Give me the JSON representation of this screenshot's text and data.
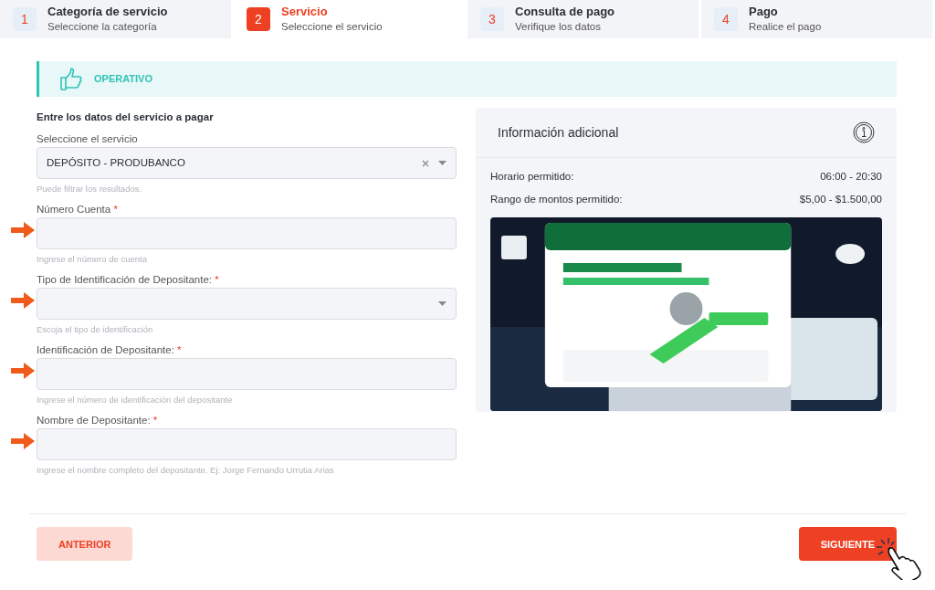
{
  "steps": [
    {
      "number": "1",
      "title": "Categoría de servicio",
      "subtitle": "Seleccione la categoría",
      "selected": false
    },
    {
      "number": "2",
      "title": "Servicio",
      "subtitle": "Seleccione el servicio",
      "selected": true
    },
    {
      "number": "3",
      "title": "Consulta de pago",
      "subtitle": "Verifique los datos",
      "selected": false
    },
    {
      "number": "4",
      "title": "Pago",
      "subtitle": "Realice el pago",
      "selected": false
    }
  ],
  "status_banner": {
    "label": "OPERATIVO"
  },
  "form": {
    "heading": "Entre los datos del servicio a pagar",
    "fields": [
      {
        "kind": "select",
        "label": "Seleccione el servicio",
        "value": "DEPÓSITO - PRODUBANCO",
        "clearable": true,
        "hint": "Puede filtrar los resultados.",
        "highlighted": false
      },
      {
        "kind": "text",
        "label": "Número Cuenta",
        "required_mark": "*",
        "hint": "Ingrese el número de cuenta",
        "highlighted": true
      },
      {
        "kind": "select",
        "label": "Tipo de Identificación de Depositante:",
        "required_mark": "*",
        "clearable": false,
        "hint": "Escoja el tipo de identificación",
        "highlighted": true
      },
      {
        "kind": "text",
        "label": "Identificación de Depositante:",
        "required_mark": "*",
        "hint": "Ingrese el número de identificación del depositante",
        "highlighted": true
      },
      {
        "kind": "text",
        "label": "Nombre de Depositante:",
        "required_mark": "*",
        "hint": "Ingrese el nombre completo del depositante. Ej: Jorge Fernando Urrutia Arias",
        "highlighted": true
      }
    ]
  },
  "info_card": {
    "title": "Información adicional",
    "rows": [
      {
        "label": "Horario permitido:",
        "value": "06:00 - 20:30"
      },
      {
        "label": "Rango de montos permitido:",
        "value": "$5,00 - $1.500,00"
      }
    ]
  },
  "buttons": [
    {
      "label": "ANTERIOR",
      "kind": "secondary",
      "hovered": false
    },
    {
      "label": "SIGUIENTE",
      "kind": "primary",
      "hovered": true
    }
  ]
}
